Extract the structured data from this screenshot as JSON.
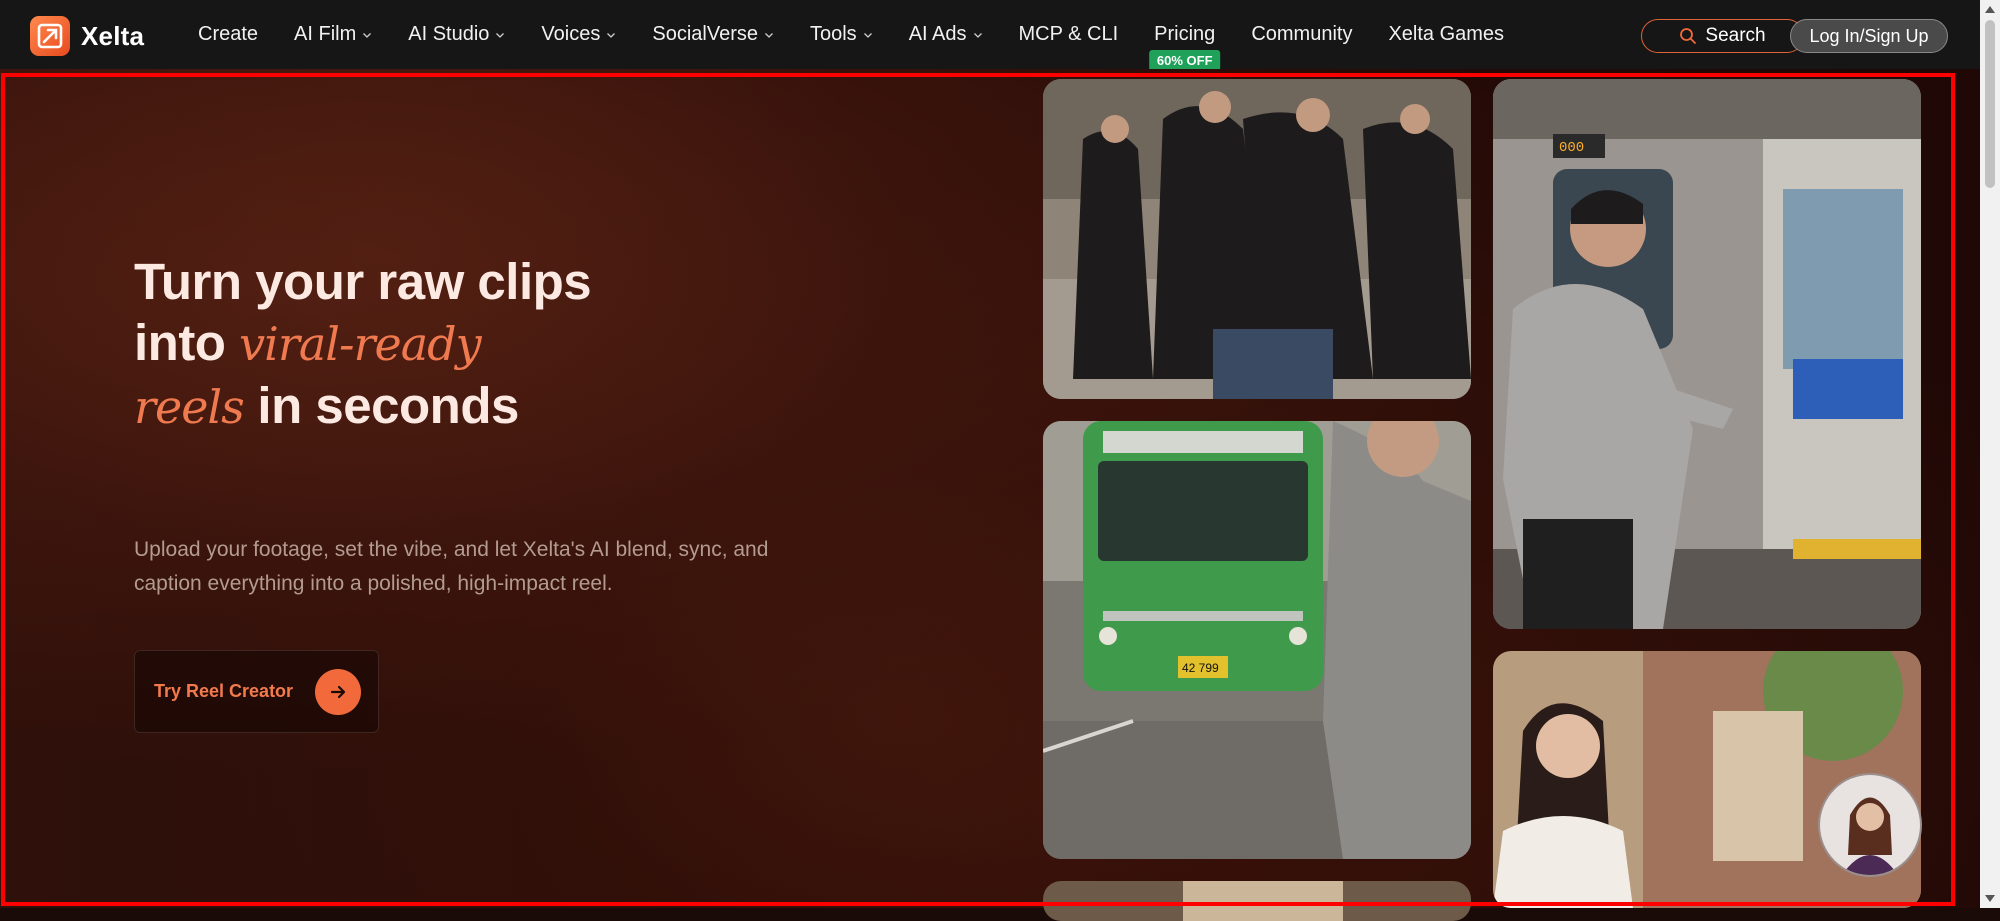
{
  "nav": {
    "brand": "Xelta",
    "items": [
      {
        "label": "Create",
        "dropdown": false
      },
      {
        "label": "AI Film",
        "dropdown": true
      },
      {
        "label": "AI Studio",
        "dropdown": true
      },
      {
        "label": "Voices",
        "dropdown": true
      },
      {
        "label": "SocialVerse",
        "dropdown": true
      },
      {
        "label": "Tools",
        "dropdown": true
      },
      {
        "label": "AI Ads",
        "dropdown": true
      },
      {
        "label": "MCP & CLI",
        "dropdown": false
      },
      {
        "label": "Pricing",
        "dropdown": false,
        "badge": "60% OFF"
      },
      {
        "label": "Community",
        "dropdown": false
      },
      {
        "label": "Xelta Games",
        "dropdown": false
      }
    ],
    "search_label": "Search",
    "login_label": "Log In/Sign Up"
  },
  "hero": {
    "headline": {
      "line1": "Turn your raw clips",
      "line2_pre": "into ",
      "line2_accent": "viral-ready",
      "line3_accent": "reels",
      "line3_post": " in seconds"
    },
    "subtext": "Upload your footage, set the vibe, and let Xelta's AI blend, sync, and caption everything into a polished, high-impact reel.",
    "cta_label": "Try Reel Creator"
  },
  "tiles": [
    {
      "name": "street-fight-clip"
    },
    {
      "name": "subway-train-clip"
    },
    {
      "name": "green-bus-clip",
      "plate": "42 799"
    },
    {
      "name": "woman-street-clip"
    }
  ],
  "colors": {
    "accent": "#f26a3b",
    "badge": "#1fa15a",
    "frame": "#ff0000",
    "background": "#2a0d08"
  }
}
